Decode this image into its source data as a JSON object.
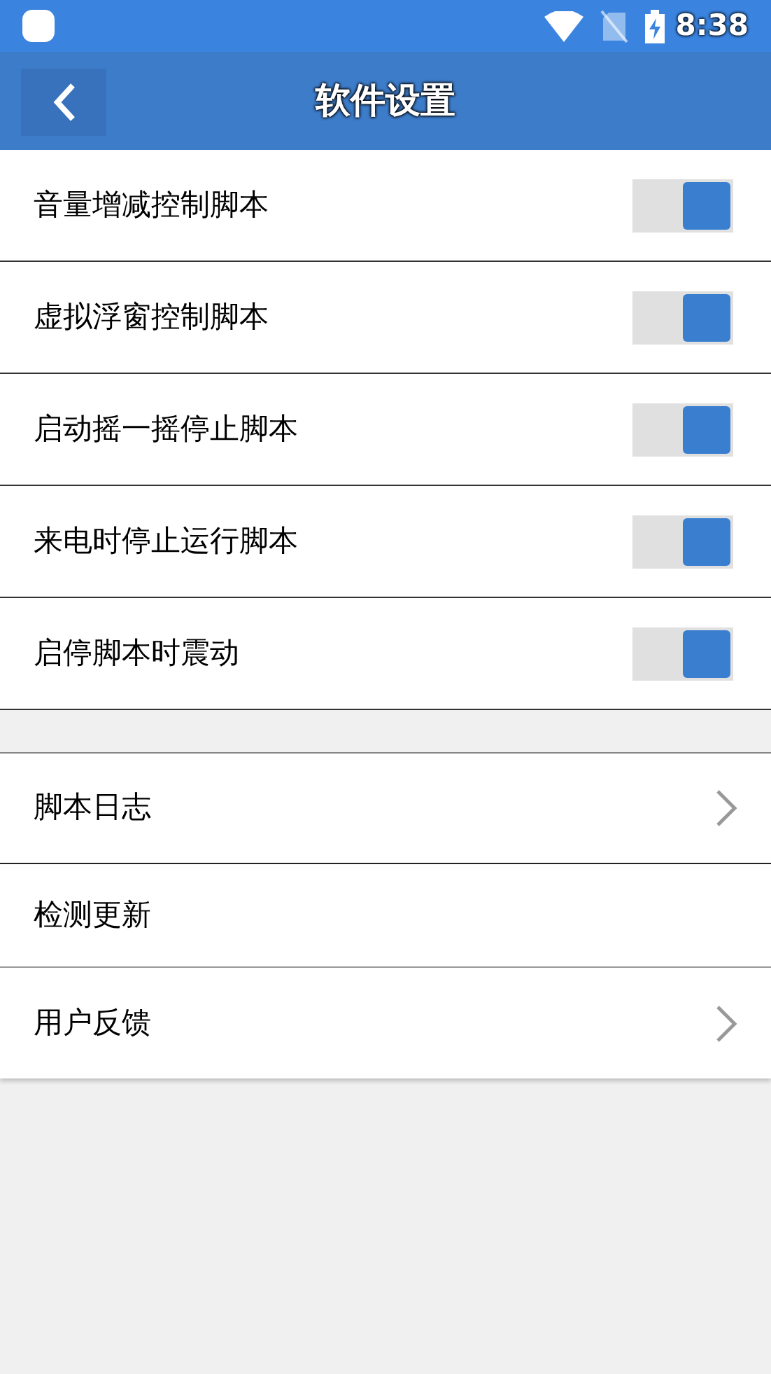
{
  "status_bar": {
    "time": "8:38"
  },
  "header": {
    "title": "软件设置"
  },
  "toggles": [
    {
      "label": "音量增减控制脚本",
      "on": true
    },
    {
      "label": "虚拟浮窗控制脚本",
      "on": true
    },
    {
      "label": "启动摇一摇停止脚本",
      "on": true
    },
    {
      "label": "来电时停止运行脚本",
      "on": true
    },
    {
      "label": "启停脚本时震动",
      "on": true
    }
  ],
  "menu": [
    {
      "label": "脚本日志",
      "chevron": true
    },
    {
      "label": "检测更新",
      "chevron": false
    },
    {
      "label": "用户反馈",
      "chevron": true
    }
  ]
}
